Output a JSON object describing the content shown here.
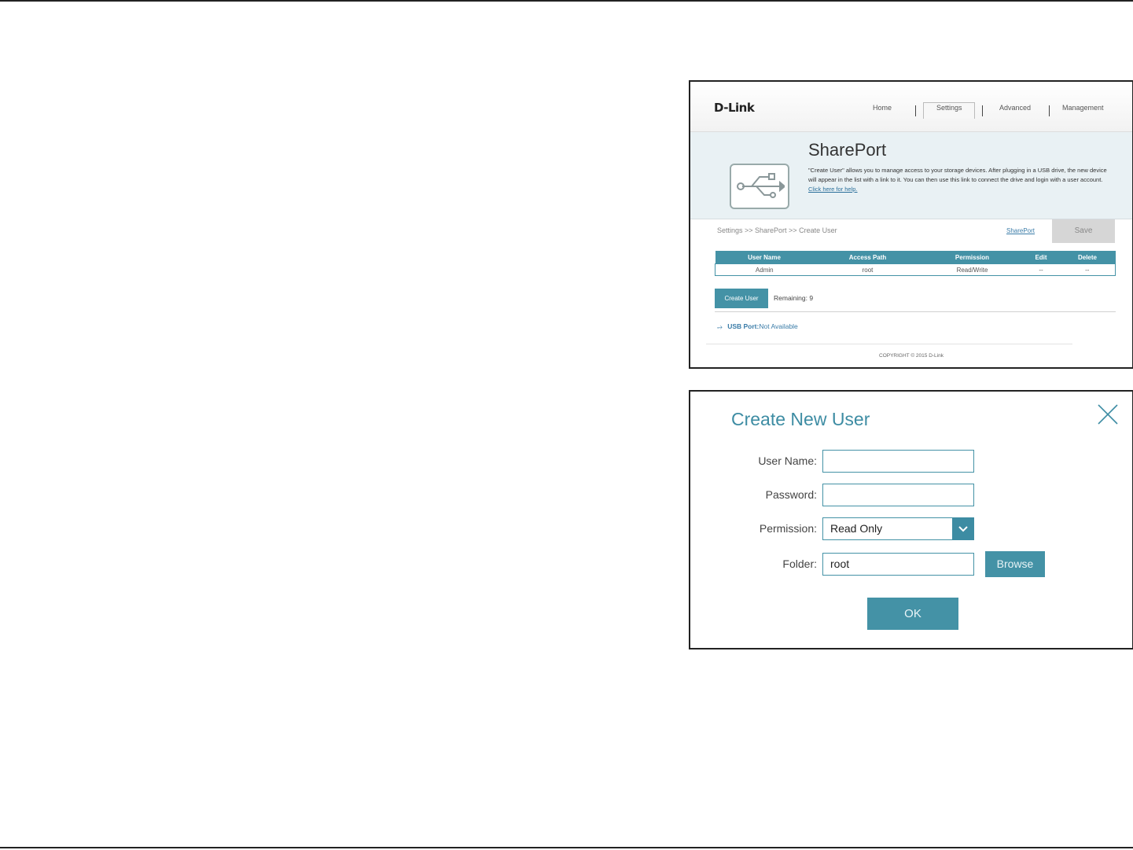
{
  "router_page": {
    "logo": "D-Link",
    "nav": [
      "Home",
      "Settings",
      "Advanced",
      "Management"
    ],
    "active_nav": "Settings",
    "title": "SharePort",
    "description_text": "\"Create User\" allows you to manage access to your storage devices. After plugging in a USB drive, the new device will appear in the list with a link to it. You can then use this link to connect the drive and login with a user account. Click here for help.",
    "help_link": "Click here for help.",
    "breadcrumb": "Settings >> SharePort >> Create User",
    "shareport_link": "SharePort",
    "save_label": "Save",
    "table": {
      "headers": [
        "User Name",
        "Access Path",
        "Permission",
        "Edit",
        "Delete"
      ],
      "rows": [
        [
          "Admin",
          "root",
          "Read/Write",
          "--",
          "--"
        ]
      ]
    },
    "create_user_label": "Create User",
    "remaining": "Remaining: 9",
    "usb_port_label": "USB Port:",
    "usb_port_status": "Not Available",
    "copyright": "COPYRIGHT © 2015 D-Link"
  },
  "dialog": {
    "title": "Create New User",
    "user_name_label": "User Name:",
    "user_name_value": "",
    "password_label": "Password:",
    "password_value": "",
    "permission_label": "Permission:",
    "permission_value": "Read Only",
    "folder_label": "Folder:",
    "folder_value": "root",
    "browse_label": "Browse",
    "ok_label": "OK"
  },
  "colors": {
    "accent": "#4492a6",
    "title_teal": "#3d8ca3",
    "link": "#3a7ca8"
  }
}
